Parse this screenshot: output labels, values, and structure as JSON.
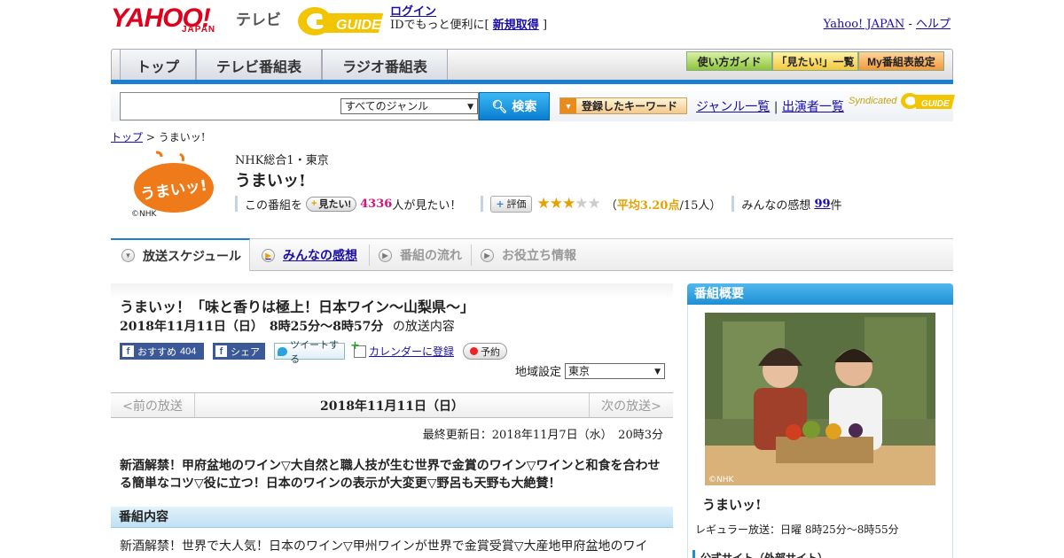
{
  "header": {
    "brand": "YAHOO!",
    "brand_sub": "JAPAN",
    "service": "テレビ",
    "guide_logo": "G GUIDE",
    "login": "ログイン",
    "login_note": "IDでもっと便利に[",
    "register": "新規取得",
    "login_close": "]",
    "top_link": "Yahoo! JAPAN",
    "separator": "-",
    "help_link": "ヘルプ"
  },
  "nav": {
    "tabs": [
      "トップ",
      "テレビ番組表",
      "ラジオ番組表"
    ],
    "buttons": [
      "使い方ガイド",
      "「見たい!」一覧",
      "My番組表設定"
    ]
  },
  "search": {
    "genre": "すべてのジャンル",
    "button": "検索",
    "keyword_button": "登録したキーワード",
    "genre_list": "ジャンル一覧",
    "divider": "|",
    "cast_list": "出演者一覧",
    "syndicated": "Syndicated"
  },
  "breadcrumb": {
    "home": "トップ",
    "sep": ">",
    "current": "うまいッ!"
  },
  "program": {
    "logo_text": "うまいッ!",
    "logo_credit": "©NHK",
    "station": "NHK総合1・東京",
    "title": "うまいッ!",
    "want_prefix": "この番組を",
    "want_button": "見たい!",
    "want_count": "4336",
    "want_suffix": "人が見たい！",
    "eval_button": "評価",
    "rating_stars": 3,
    "rating_open": "（",
    "rating_avg": "平均3.20点",
    "rating_count": "/15人）",
    "impressions_label": "みんなの感想",
    "impressions_count": "99",
    "impressions_unit": "件"
  },
  "tabs": [
    {
      "label": "放送スケジュール",
      "state": "active"
    },
    {
      "label": "みんなの感想",
      "state": "link"
    },
    {
      "label": "番組の流れ",
      "state": "disabled"
    },
    {
      "label": "お役立ち情報",
      "state": "disabled"
    }
  ],
  "episode": {
    "title": "うまいッ！「味と香りは極上！日本ワイン～山梨県～」",
    "date_time": "2018年11月11日（日）　8時25分～8時57分",
    "date_suffix": "の放送内容",
    "fb_recommend": "おすすめ",
    "fb_count": "404",
    "fb_share": "シェア",
    "tweet": "ツイートする",
    "calendar": "カレンダーに登録",
    "reserve": "予約",
    "region_label": "地域設定",
    "region_value": "東京"
  },
  "pager": {
    "prev": "<前の放送",
    "date": "2018年11月11日（日）",
    "next": "次の放送>"
  },
  "updated": "最終更新日：2018年11月7日（水）　20時3分",
  "lead": "新酒解禁！甲府盆地のワイン▽大自然と職人技が生む世界で金賞のワイン▽ワインと和食を合わせる簡単なコツ▽役に立つ！日本のワインの表示が大変更▽野呂も天野も大絶賛！",
  "section": {
    "heading": "番組内容",
    "body": "新酒解禁！世界で大人気！日本のワイン▽甲州ワインが世界で金賞受賞▽大産地甲府盆地のワイ"
  },
  "sidebar": {
    "heading": "番組概要",
    "photo_credit": "©NHK",
    "name": "うまいッ!",
    "regular": "レギュラー放送：日曜 8時25分～8時55分",
    "official": "公式サイト（外部サイト）"
  },
  "colors": {
    "yahoo_red": "#e0001b",
    "accent_blue": "#1a7fd0",
    "want_pink": "#d1157a",
    "star_gold": "#e6a100"
  }
}
